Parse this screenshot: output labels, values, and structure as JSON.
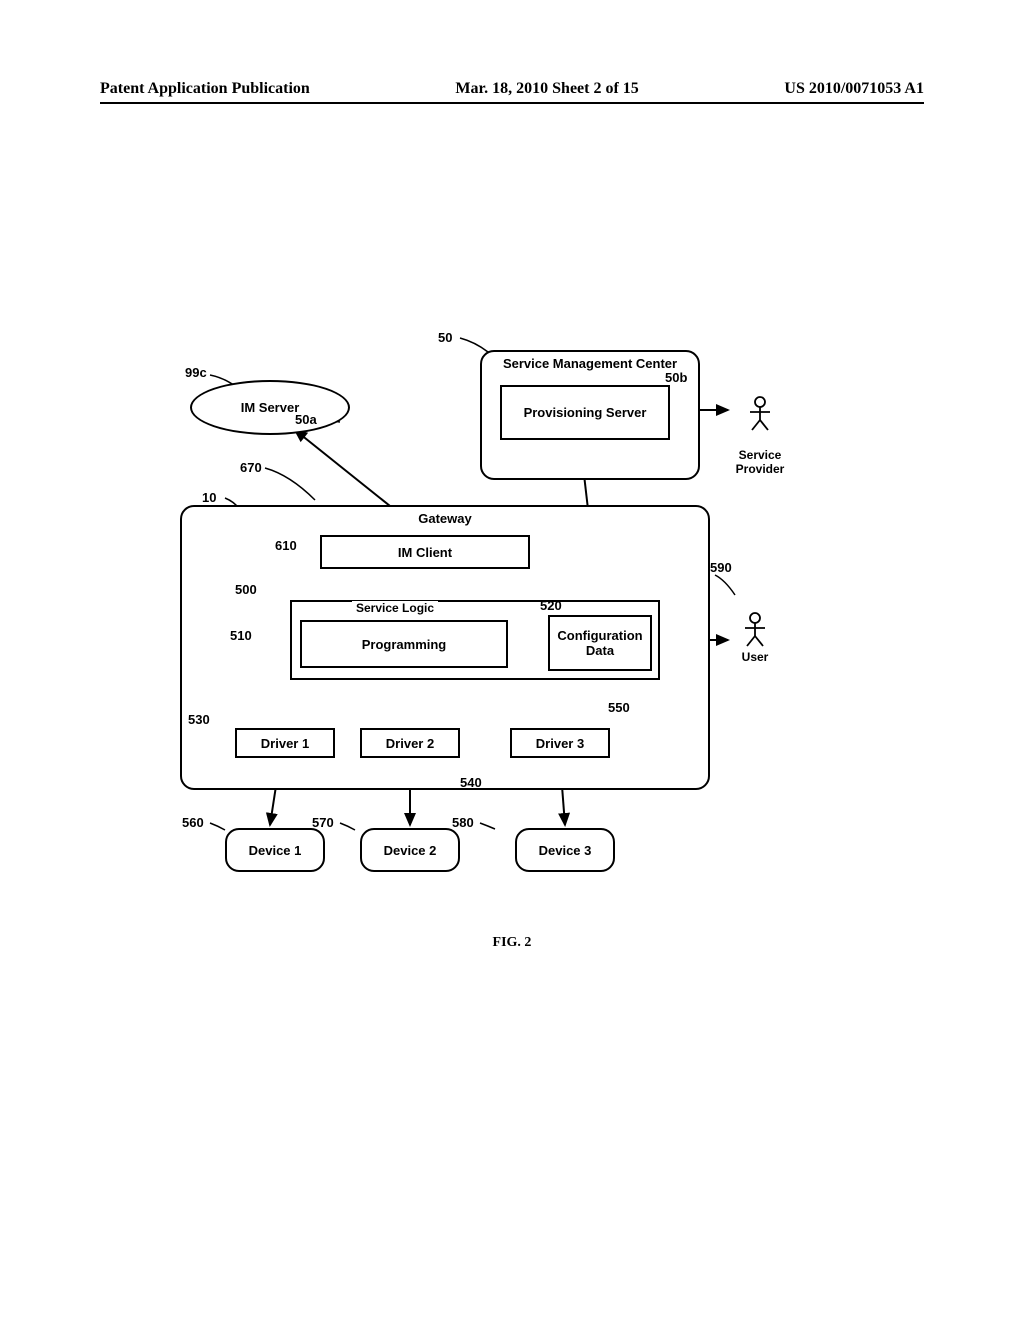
{
  "header": {
    "left": "Patent Application Publication",
    "center": "Mar. 18, 2010  Sheet 2 of 15",
    "right": "US 2010/0071053 A1"
  },
  "figure_caption": "FIG. 2",
  "labels": {
    "n99c": "99c",
    "n50": "50",
    "n50a": "50a",
    "n50b": "50b",
    "n670": "670",
    "n10": "10",
    "n610": "610",
    "n500": "500",
    "n510": "510",
    "n520": "520",
    "n530": "530",
    "n540": "540",
    "n550": "550",
    "n560": "560",
    "n570": "570",
    "n580": "580",
    "n590": "590"
  },
  "boxes": {
    "im_server": "IM Server",
    "smc": "Service Management Center",
    "prov": "Provisioning Server",
    "gateway": "Gateway",
    "im_client": "IM Client",
    "service_logic": "Service Logic",
    "programming": "Programming",
    "config": "Configuration\nData",
    "driver1": "Driver 1",
    "driver2": "Driver 2",
    "driver3": "Driver 3",
    "device1": "Device 1",
    "device2": "Device 2",
    "device3": "Device 3"
  },
  "actors": {
    "sp": "Service\nProvider",
    "user": "User"
  }
}
